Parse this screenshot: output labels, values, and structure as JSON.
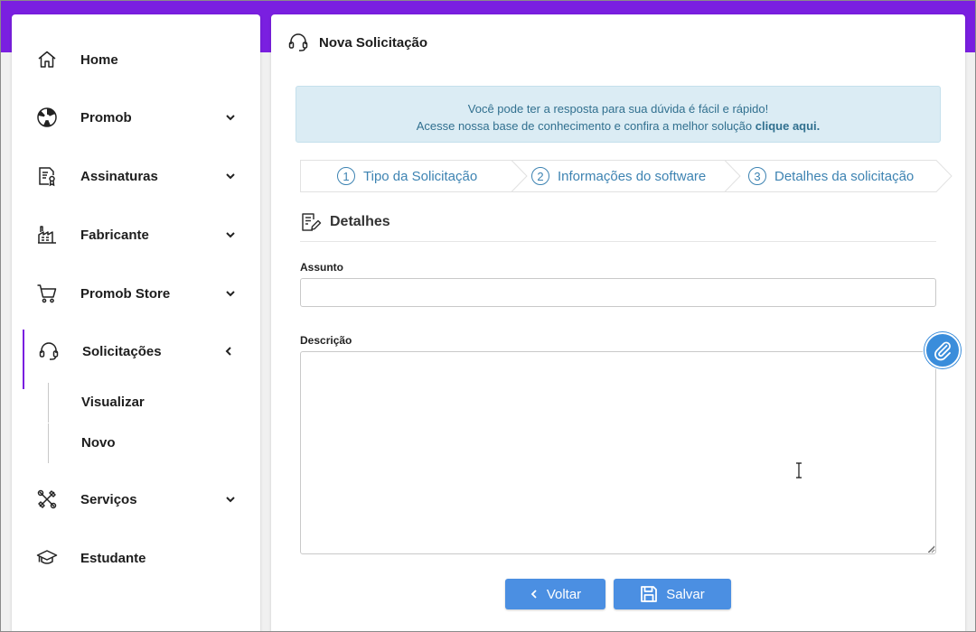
{
  "colors": {
    "brand_purple": "#7a1fe0",
    "info_bg": "#dbecf4",
    "info_text": "#31708f",
    "step_text": "#3d83b2",
    "button_blue": "#4b8fe2"
  },
  "sidebar": {
    "items": [
      {
        "label": "Home",
        "icon": "home-icon",
        "expandable": false
      },
      {
        "label": "Promob",
        "icon": "promob-logo-icon",
        "expandable": true
      },
      {
        "label": "Assinaturas",
        "icon": "certificate-document-icon",
        "expandable": true
      },
      {
        "label": "Fabricante",
        "icon": "factory-icon",
        "expandable": true
      },
      {
        "label": "Promob Store",
        "icon": "shopping-cart-icon",
        "expandable": true
      },
      {
        "label": "Solicitações",
        "icon": "headset-icon",
        "expandable": true,
        "expanded": true,
        "active": true
      },
      {
        "label": "Serviços",
        "icon": "tools-icon",
        "expandable": true
      },
      {
        "label": "Estudante",
        "icon": "graduation-cap-icon",
        "expandable": false
      }
    ],
    "submenu": [
      {
        "label": "Visualizar"
      },
      {
        "label": "Novo"
      }
    ]
  },
  "main": {
    "title": "Nova Solicitação",
    "info": {
      "line1": "Você pode ter a resposta para sua dúvida é fácil e rápido!",
      "line2_prefix": "Acesse nossa base de conhecimento e confira a melhor solução ",
      "link": "clique aqui."
    },
    "steps": [
      {
        "num": "1",
        "label": "Tipo da Solicitação"
      },
      {
        "num": "2",
        "label": "Informações do software"
      },
      {
        "num": "3",
        "label": "Detalhes da solicitação"
      }
    ],
    "section_title": "Detalhes",
    "fields": {
      "subject_label": "Assunto",
      "subject_value": "",
      "description_label": "Descrição",
      "description_value": ""
    },
    "buttons": {
      "back": "Voltar",
      "save": "Salvar"
    }
  }
}
